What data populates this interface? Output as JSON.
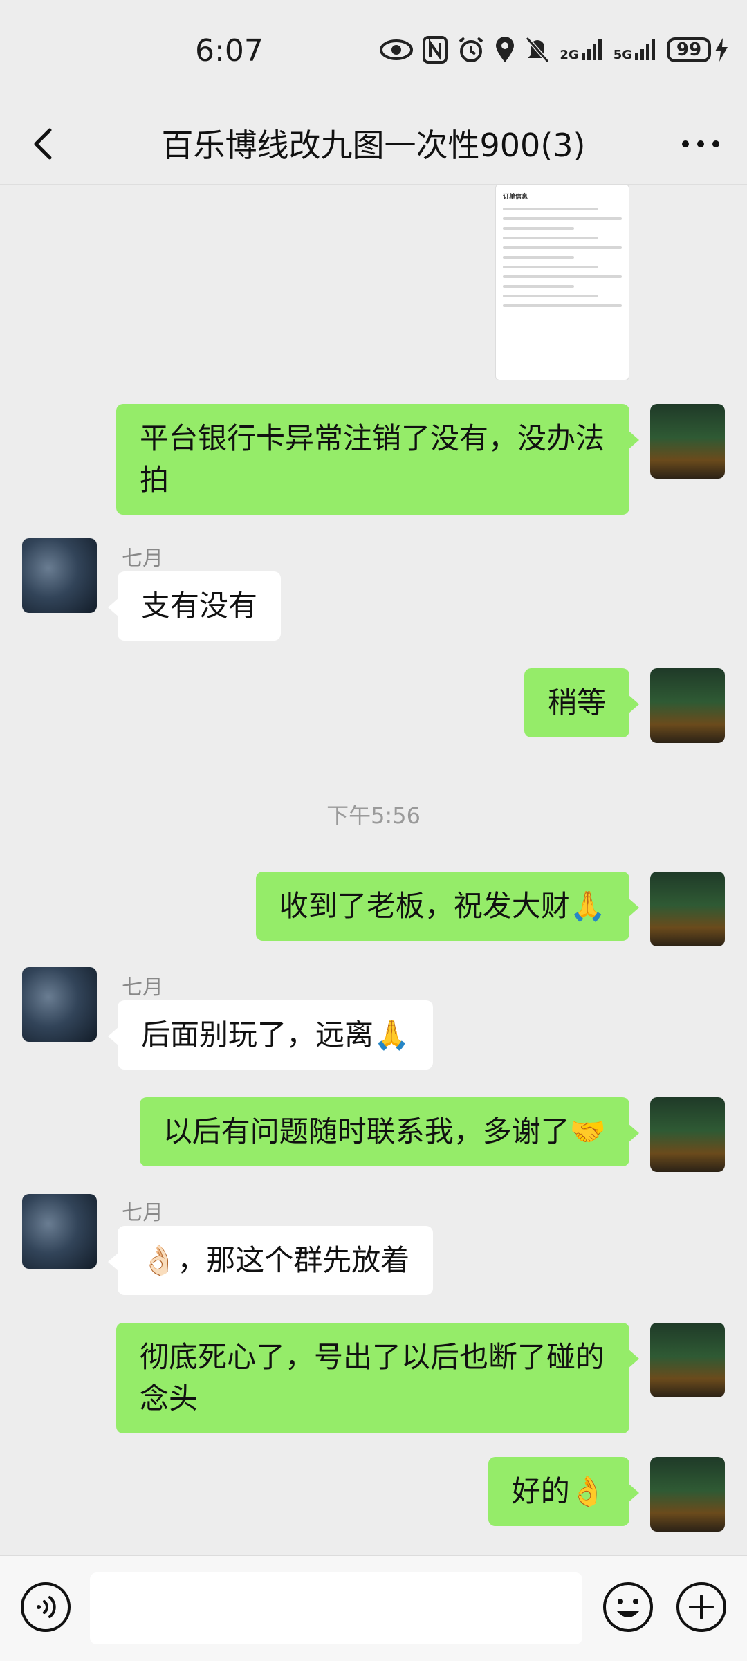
{
  "status_bar": {
    "time": "6:07",
    "net1": "2G",
    "net2": "5G",
    "battery": "99"
  },
  "header": {
    "title": "百乐博线改九图一次性900(3)"
  },
  "order_card": {
    "title": "订单信息"
  },
  "messages": [
    {
      "side": "me",
      "text": "平台银行卡异常注销了没有，没办法拍"
    },
    {
      "side": "other",
      "sender": "七月",
      "text": "支有没有"
    },
    {
      "side": "me",
      "text": "稍等"
    },
    {
      "type": "time",
      "text": "下午5:56"
    },
    {
      "side": "me",
      "text": "收到了老板，祝发大财🙏"
    },
    {
      "side": "other",
      "sender": "七月",
      "text": "后面别玩了，远离🙏"
    },
    {
      "side": "me",
      "text": "以后有问题随时联系我，多谢了🤝"
    },
    {
      "side": "other",
      "sender": "七月",
      "text": "👌🏻，那这个群先放着"
    },
    {
      "side": "me",
      "text": "彻底死心了，号出了以后也断了碰的念头"
    },
    {
      "side": "me",
      "text": "好的👌"
    }
  ],
  "colors": {
    "my_bubble": "#95ec69",
    "other_bubble": "#ffffff",
    "background": "#ededed"
  },
  "icons": {
    "back": "chevron-left-icon",
    "more": "more-dots-icon",
    "voice": "voice-icon",
    "emoji": "emoji-icon",
    "plus": "plus-icon"
  }
}
